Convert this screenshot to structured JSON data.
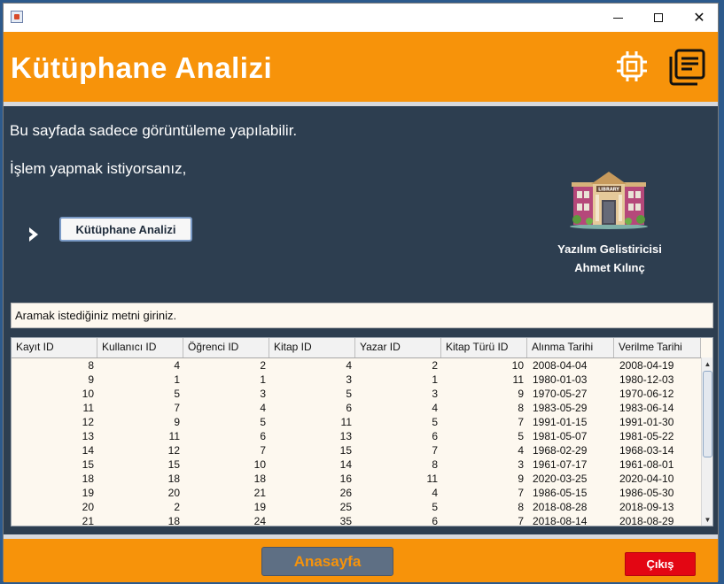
{
  "colors": {
    "header": "#f7930a",
    "panel": "#2d3e50",
    "exit": "#e30613",
    "home_button": "#5e6f84"
  },
  "window": {
    "title": ""
  },
  "header": {
    "title": "Kütüphane Analizi",
    "icons": [
      "chip-icon",
      "document-list-icon"
    ]
  },
  "main": {
    "info_line1": "Bu sayfada sadece görüntüleme yapılabilir.",
    "info_line2": "İşlem yapmak istiyorsanız,",
    "action_button": "Kütüphane Analizi",
    "developer_label": "Yazılım Gelistiricisi",
    "developer_name": "Ahmet Kılınç"
  },
  "search": {
    "placeholder": "Aramak istediğiniz metni giriniz."
  },
  "table": {
    "columns": [
      "Kayıt ID",
      "Kullanıcı ID",
      "Öğrenci ID",
      "Kitap ID",
      "Yazar ID",
      "Kitap Türü ID",
      "Alınma Tarihi",
      "Verilme Tarihi"
    ],
    "rows": [
      [
        "8",
        "4",
        "2",
        "4",
        "2",
        "10",
        "2008-04-04",
        "2008-04-19"
      ],
      [
        "9",
        "1",
        "1",
        "3",
        "1",
        "11",
        "1980-01-03",
        "1980-12-03"
      ],
      [
        "10",
        "5",
        "3",
        "5",
        "3",
        "9",
        "1970-05-27",
        "1970-06-12"
      ],
      [
        "11",
        "7",
        "4",
        "6",
        "4",
        "8",
        "1983-05-29",
        "1983-06-14"
      ],
      [
        "12",
        "9",
        "5",
        "11",
        "5",
        "7",
        "1991-01-15",
        "1991-01-30"
      ],
      [
        "13",
        "11",
        "6",
        "13",
        "6",
        "5",
        "1981-05-07",
        "1981-05-22"
      ],
      [
        "14",
        "12",
        "7",
        "15",
        "7",
        "4",
        "1968-02-29",
        "1968-03-14"
      ],
      [
        "15",
        "15",
        "10",
        "14",
        "8",
        "3",
        "1961-07-17",
        "1961-08-01"
      ],
      [
        "18",
        "18",
        "18",
        "16",
        "11",
        "9",
        "2020-03-25",
        "2020-04-10"
      ],
      [
        "19",
        "20",
        "21",
        "26",
        "4",
        "7",
        "1986-05-15",
        "1986-05-30"
      ],
      [
        "20",
        "2",
        "19",
        "25",
        "5",
        "8",
        "2018-08-28",
        "2018-09-13"
      ],
      [
        "21",
        "18",
        "24",
        "35",
        "6",
        "7",
        "2018-08-14",
        "2018-08-29"
      ]
    ]
  },
  "footer": {
    "home_button": "Anasayfa",
    "exit_button": "Çıkış"
  }
}
